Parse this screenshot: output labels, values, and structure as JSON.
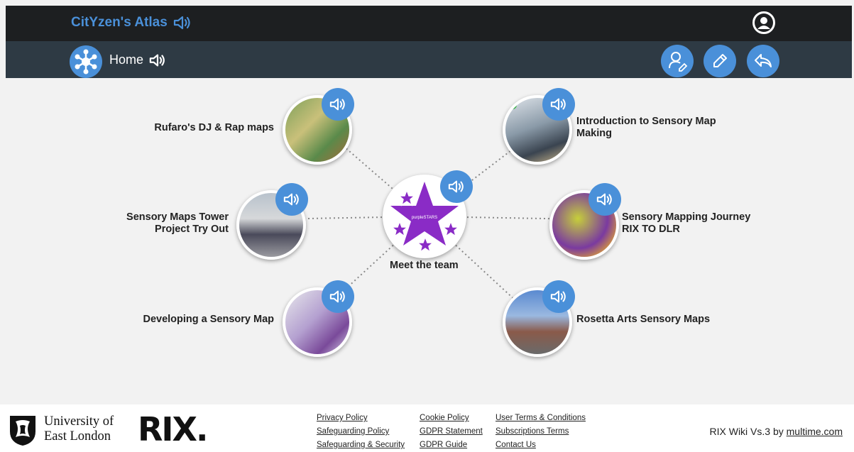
{
  "header": {
    "app_title": "CitYzen's Atlas"
  },
  "subheader": {
    "title": "Home"
  },
  "center": {
    "label": "Meet the team",
    "badge_text": "purpleSTARS"
  },
  "nodes": [
    {
      "label": "Rufaro's DJ & Rap maps"
    },
    {
      "label": "Introduction to Sensory Map Making"
    },
    {
      "label": "Sensory Maps Tower Project Try Out"
    },
    {
      "label": "Sensory Mapping Journey RIX TO DLR"
    },
    {
      "label": "Developing a Sensory Map"
    },
    {
      "label": "Rosetta Arts Sensory Maps"
    }
  ],
  "footer": {
    "university": "University of East London",
    "rix": "RIX.",
    "links": [
      "Privacy Policy",
      "Safeguarding Policy",
      "Safeguarding & Security",
      "Cookie Policy",
      "GDPR Statement",
      "GDPR Guide",
      "User Terms & Conditions",
      "Subscriptions Terms",
      "Contact Us"
    ],
    "credit_prefix": "RIX Wiki Vs.3 by ",
    "credit_link": "multime.com"
  },
  "colors": {
    "accent": "#4a90d9",
    "topbar": "#1d1f21",
    "subbar": "#2e3a44",
    "star_purple": "#8a2bc6"
  }
}
